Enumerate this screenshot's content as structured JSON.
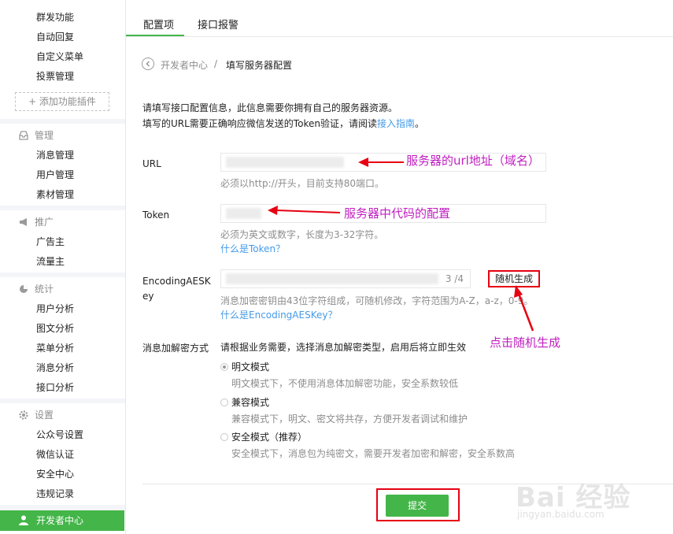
{
  "sidebar": {
    "top_items": [
      "群发功能",
      "自动回复",
      "自定义菜单",
      "投票管理"
    ],
    "add_plugin": "+ 添加功能插件",
    "groups": [
      {
        "title": "管理",
        "items": [
          "消息管理",
          "用户管理",
          "素材管理"
        ]
      },
      {
        "title": "推广",
        "items": [
          "广告主",
          "流量主"
        ]
      },
      {
        "title": "统计",
        "items": [
          "用户分析",
          "图文分析",
          "菜单分析",
          "消息分析",
          "接口分析"
        ]
      },
      {
        "title": "设置",
        "items": [
          "公众号设置",
          "微信认证",
          "安全中心",
          "违规记录"
        ]
      }
    ],
    "active_item": "开发者中心"
  },
  "tabs": [
    "配置项",
    "接口报警"
  ],
  "breadcrumb": {
    "parent": "开发者中心",
    "sep": "/",
    "current": "填写服务器配置"
  },
  "intro": {
    "line1": "请填写接口配置信息，此信息需要你拥有自己的服务器资源。",
    "line2_prefix": "填写的URL需要正确响应微信发送的Token验证，请阅读",
    "line2_link": "接入指南",
    "line2_suffix": "。"
  },
  "form": {
    "url": {
      "label": "URL",
      "hint": "必须以http://开头，目前支持80端口。"
    },
    "token": {
      "label": "Token",
      "hint": "必须为英文或数字，长度为3-32字符。",
      "link": "什么是Token？"
    },
    "aeskey": {
      "label_line1": "EncodingAESK",
      "label_line2": "ey",
      "counter": "3 /4",
      "button": "随机生成",
      "hint": "消息加密密钥由43位字符组成，可随机修改，字符范围为A-Z，a-z，0-9。",
      "link": "什么是EncodingAESKey？"
    },
    "encrypt": {
      "label": "消息加解密方式",
      "desc": "请根据业务需要，选择消息加解密类型，启用后将立即生效",
      "options": [
        {
          "label": "明文模式",
          "desc": "明文模式下，不使用消息体加解密功能，安全系数较低",
          "selected": true
        },
        {
          "label": "兼容模式",
          "desc": "兼容模式下，明文、密文将共存，方便开发者调试和维护",
          "selected": false
        },
        {
          "label": "安全模式（推荐）",
          "desc": "安全模式下，消息包为纯密文，需要开发者加密和解密，安全系数高",
          "selected": false
        }
      ]
    },
    "submit": "提交"
  },
  "annotations": {
    "url": "服务器的url地址（域名）",
    "token": "服务器中代码的配置",
    "random": "点击随机生成"
  },
  "watermark": {
    "text": "Bai 经验",
    "url": "jingyan.baidu.com"
  },
  "colors": {
    "brand": "#44b549",
    "link": "#459ae9",
    "annotation": "#c020c0",
    "highlight": "#e60012"
  }
}
